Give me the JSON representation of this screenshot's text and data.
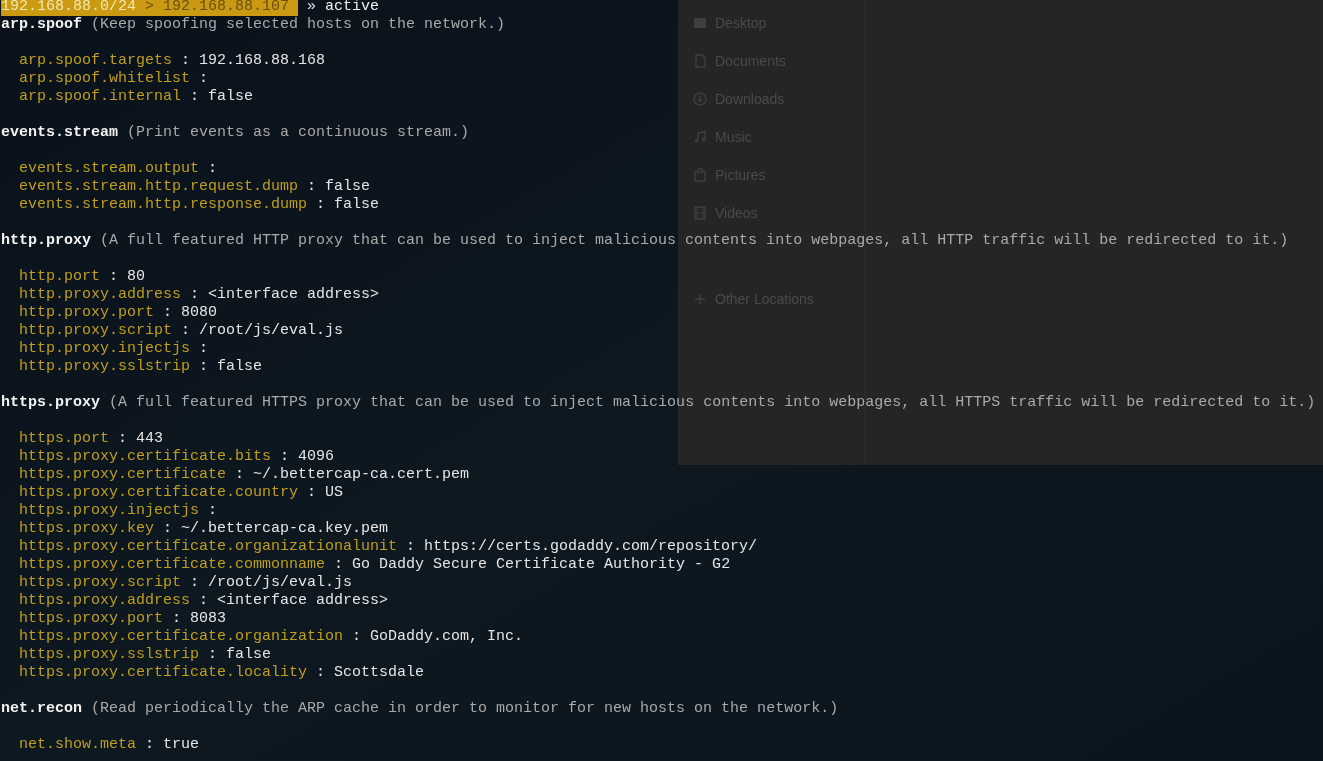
{
  "prompt": {
    "subnet": "192.168.88.0/24",
    "separator": ">",
    "host": "192.168.88.107",
    "arrow": "»",
    "state": "active"
  },
  "modules": [
    {
      "name": "arp.spoof",
      "description": "(Keep spoofing selected hosts on the network.)",
      "params": [
        {
          "key": "arp.spoof.targets",
          "value": ": 192.168.88.168"
        },
        {
          "key": "arp.spoof.whitelist",
          "value": ":"
        },
        {
          "key": "arp.spoof.internal",
          "value": ": false"
        }
      ]
    },
    {
      "name": "events.stream",
      "description": "(Print events as a continuous stream.)",
      "params": [
        {
          "key": "events.stream.output",
          "value": ":"
        },
        {
          "key": "events.stream.http.request.dump",
          "value": ": false"
        },
        {
          "key": "events.stream.http.response.dump",
          "value": ": false"
        }
      ]
    },
    {
      "name": "http.proxy",
      "description": "(A full featured HTTP proxy that can be used to inject malicious contents into webpages, all HTTP traffic will be redirected to it.)",
      "params": [
        {
          "key": "http.port",
          "value": ": 80"
        },
        {
          "key": "http.proxy.address",
          "value": ": <interface address>"
        },
        {
          "key": "http.proxy.port",
          "value": ": 8080"
        },
        {
          "key": "http.proxy.script",
          "value": ": /root/js/eval.js"
        },
        {
          "key": "http.proxy.injectjs",
          "value": ":"
        },
        {
          "key": "http.proxy.sslstrip",
          "value": ": false"
        }
      ]
    },
    {
      "name": "https.proxy",
      "description": "(A full featured HTTPS proxy that can be used to inject malicious contents into webpages, all HTTPS traffic will be redirected to it.)",
      "params": [
        {
          "key": "https.port",
          "value": ": 443"
        },
        {
          "key": "https.proxy.certificate.bits",
          "value": ": 4096"
        },
        {
          "key": "https.proxy.certificate",
          "value": ": ~/.bettercap-ca.cert.pem"
        },
        {
          "key": "https.proxy.certificate.country",
          "value": ": US"
        },
        {
          "key": "https.proxy.injectjs",
          "value": ":"
        },
        {
          "key": "https.proxy.key",
          "value": ": ~/.bettercap-ca.key.pem"
        },
        {
          "key": "https.proxy.certificate.organizationalunit",
          "value": ": https://certs.godaddy.com/repository/"
        },
        {
          "key": "https.proxy.certificate.commonname",
          "value": ": Go Daddy Secure Certificate Authority - G2"
        },
        {
          "key": "https.proxy.script",
          "value": ": /root/js/eval.js"
        },
        {
          "key": "https.proxy.address",
          "value": ": <interface address>"
        },
        {
          "key": "https.proxy.port",
          "value": ": 8083"
        },
        {
          "key": "https.proxy.certificate.organization",
          "value": ": GoDaddy.com, Inc."
        },
        {
          "key": "https.proxy.sslstrip",
          "value": ": false"
        },
        {
          "key": "https.proxy.certificate.locality",
          "value": ": Scottsdale"
        }
      ]
    },
    {
      "name": "net.recon",
      "description": "(Read periodically the ARP cache in order to monitor for new hosts on the network.)",
      "params": [
        {
          "key": "net.show.meta",
          "value": ": true"
        }
      ]
    }
  ],
  "file_manager": {
    "places": [
      {
        "label": "Desktop",
        "kind": "desktop"
      },
      {
        "label": "Documents",
        "kind": "document"
      },
      {
        "label": "Downloads",
        "kind": "download"
      },
      {
        "label": "Music",
        "kind": "music"
      },
      {
        "label": "Pictures",
        "kind": "pictures"
      },
      {
        "label": "Videos",
        "kind": "video"
      },
      {
        "label": "Other Locations",
        "kind": "other"
      }
    ]
  }
}
